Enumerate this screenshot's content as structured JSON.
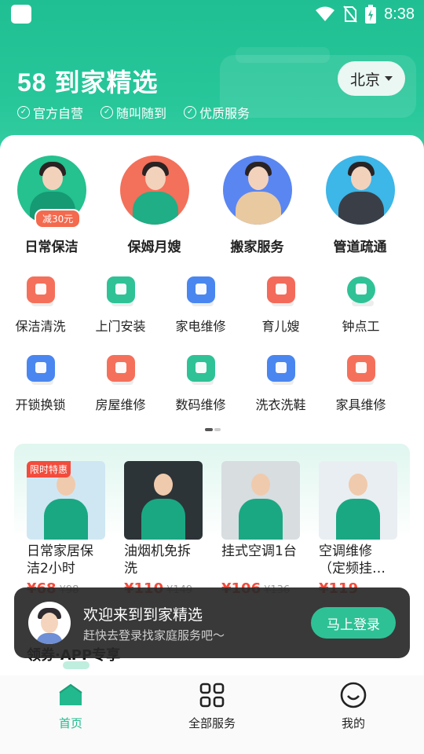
{
  "status_bar": {
    "time": "8:38"
  },
  "header": {
    "brand": "58 到家精选",
    "city": "北京",
    "tags": [
      "官方自营",
      "随叫随到",
      "优质服务"
    ]
  },
  "top_services": [
    {
      "label": "日常保洁",
      "badge": "减30元",
      "color": "#25c18f"
    },
    {
      "label": "保姆月嫂",
      "badge": "",
      "color": "#f3705a"
    },
    {
      "label": "搬家服务",
      "badge": "",
      "color": "#5a86f2"
    },
    {
      "label": "管道疏通",
      "badge": "",
      "color": "#3db6e8"
    }
  ],
  "services_grid": [
    [
      {
        "label": "保洁清洗",
        "icon": "bag-icon",
        "color": "#f5705a"
      },
      {
        "label": "上门安装",
        "icon": "toolbox-icon",
        "color": "#2fc296"
      },
      {
        "label": "家电维修",
        "icon": "fridge-icon",
        "color": "#4a86f0"
      },
      {
        "label": "育儿嫂",
        "icon": "baby-bottle-icon",
        "color": "#f36a5a"
      },
      {
        "label": "钟点工",
        "icon": "lightning-icon",
        "color": "#2fc296"
      }
    ],
    [
      {
        "label": "开锁换锁",
        "icon": "lock-icon",
        "color": "#4a86f0"
      },
      {
        "label": "房屋维修",
        "icon": "wrench-icon",
        "color": "#f5705a"
      },
      {
        "label": "数码维修",
        "icon": "camera-icon",
        "color": "#2fc296"
      },
      {
        "label": "洗衣洗鞋",
        "icon": "shirt-icon",
        "color": "#4a86f0"
      },
      {
        "label": "家具维修",
        "icon": "wrench-icon",
        "color": "#f5705a"
      }
    ]
  ],
  "promo": {
    "ribbon": "限时特惠",
    "items": [
      {
        "title": "日常家居保洁2小时",
        "price": "¥68",
        "orig": "¥98",
        "bg": "#cfe7f3"
      },
      {
        "title": "油烟机免拆洗",
        "price": "¥110",
        "orig": "¥149",
        "bg": "#2c3438"
      },
      {
        "title": "挂式空调1台",
        "price": "¥106",
        "orig": "¥136",
        "bg": "#d8dde0"
      },
      {
        "title": "空调维修（定频挂…",
        "price": "¥119",
        "orig": "",
        "bg": "#e9eef2"
      }
    ]
  },
  "coupon": {
    "title": "领券·APP专享"
  },
  "toast": {
    "title": "欢迎来到到家精选",
    "subtitle": "赶快去登录找家庭服务吧～",
    "button": "马上登录"
  },
  "bottom_nav": [
    {
      "label": "首页",
      "active": true
    },
    {
      "label": "全部服务",
      "active": false
    },
    {
      "label": "我的",
      "active": false
    }
  ],
  "colors": {
    "brand": "#23b98e",
    "price": "#f24c3d"
  }
}
